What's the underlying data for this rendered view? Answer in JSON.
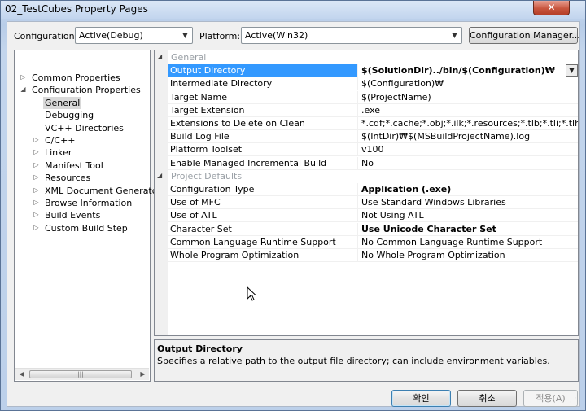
{
  "window": {
    "title": "02_TestCubes Property Pages",
    "close_label": "✕"
  },
  "toolbar": {
    "configuration_label": "Configuration:",
    "configuration_value": "Active(Debug)",
    "platform_label": "Platform:",
    "platform_value": "Active(Win32)",
    "config_manager_label": "Configuration Manager..."
  },
  "tree": {
    "items": [
      {
        "label": "Common Properties",
        "expander": "▷"
      },
      {
        "label": "Configuration Properties",
        "expander": "◢"
      },
      {
        "label": "General",
        "expander": ""
      },
      {
        "label": "Debugging",
        "expander": ""
      },
      {
        "label": "VC++ Directories",
        "expander": ""
      },
      {
        "label": "C/C++",
        "expander": "▷"
      },
      {
        "label": "Linker",
        "expander": "▷"
      },
      {
        "label": "Manifest Tool",
        "expander": "▷"
      },
      {
        "label": "Resources",
        "expander": "▷"
      },
      {
        "label": "XML Document Generator",
        "expander": "▷"
      },
      {
        "label": "Browse Information",
        "expander": "▷"
      },
      {
        "label": "Build Events",
        "expander": "▷"
      },
      {
        "label": "Custom Build Step",
        "expander": "▷"
      }
    ],
    "scroll_left": "◀",
    "scroll_right": "▶",
    "scroll_grip": "|||"
  },
  "grid": {
    "category_expander": "◢",
    "categories": [
      {
        "name": "General",
        "rows": [
          {
            "name": "Output Directory",
            "value": "$(SolutionDir)../bin/$(Configuration)₩"
          },
          {
            "name": "Intermediate Directory",
            "value": "$(Configuration)₩"
          },
          {
            "name": "Target Name",
            "value": "$(ProjectName)"
          },
          {
            "name": "Target Extension",
            "value": ".exe"
          },
          {
            "name": "Extensions to Delete on Clean",
            "value": "*.cdf;*.cache;*.obj;*.ilk;*.resources;*.tlb;*.tli;*.tlh;*.tmp;*.rsp;"
          },
          {
            "name": "Build Log File",
            "value": "$(IntDir)₩$(MSBuildProjectName).log"
          },
          {
            "name": "Platform Toolset",
            "value": "v100"
          },
          {
            "name": "Enable Managed Incremental Build",
            "value": "No"
          }
        ]
      },
      {
        "name": "Project Defaults",
        "rows": [
          {
            "name": "Configuration Type",
            "value": "Application (.exe)"
          },
          {
            "name": "Use of MFC",
            "value": "Use Standard Windows Libraries"
          },
          {
            "name": "Use of ATL",
            "value": "Not Using ATL"
          },
          {
            "name": "Character Set",
            "value": "Use Unicode Character Set"
          },
          {
            "name": "Common Language Runtime Support",
            "value": "No Common Language Runtime Support"
          },
          {
            "name": "Whole Program Optimization",
            "value": "No Whole Program Optimization"
          }
        ]
      }
    ],
    "dropdown_arrow": "▼"
  },
  "description": {
    "title": "Output Directory",
    "text": "Specifies a relative path to the output file directory; can include environment variables."
  },
  "buttons": {
    "ok": "확인",
    "cancel": "취소",
    "apply": "적용(A)"
  },
  "colors": {
    "selection": "#3399ff",
    "category_text": "#9aa0a6"
  }
}
